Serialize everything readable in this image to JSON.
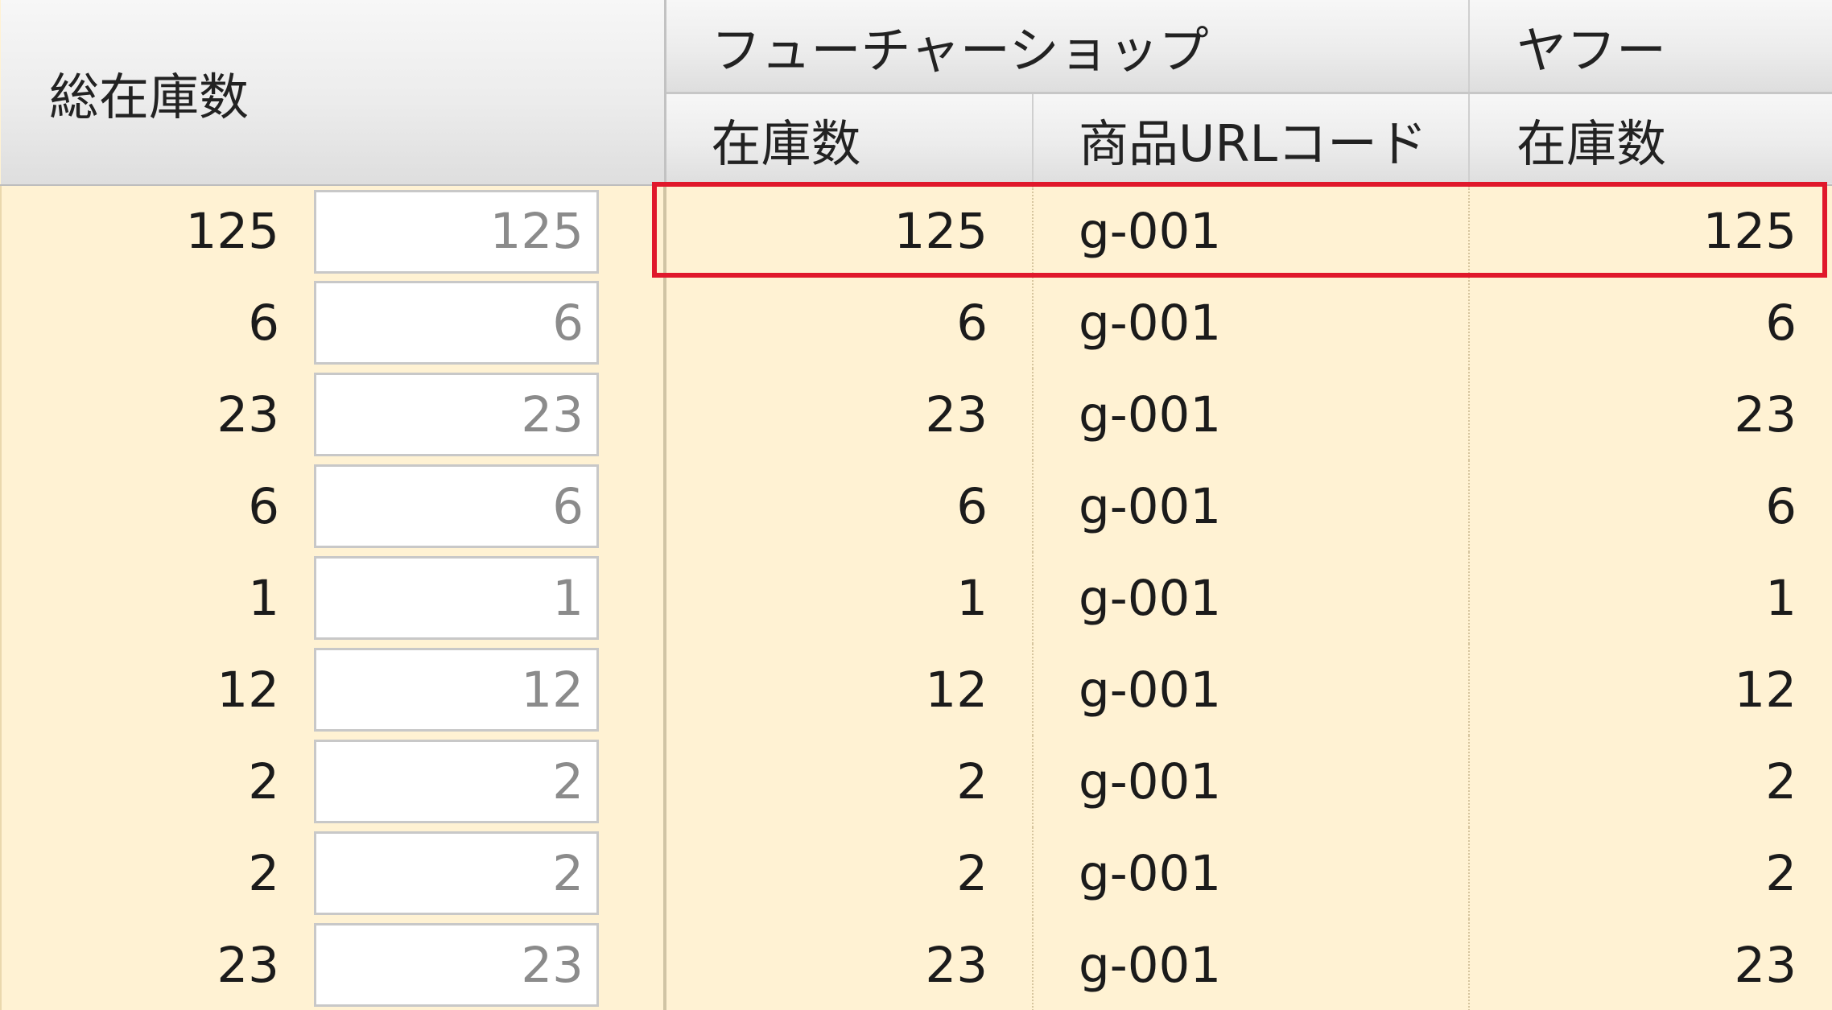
{
  "header": {
    "total_stock": "総在庫数",
    "future_shop": "フューチャーショップ",
    "yahoo": "ヤフー",
    "future_shop_stock": "在庫数",
    "future_shop_url_code": "商品URLコード",
    "yahoo_stock": "在庫数"
  },
  "rows": [
    {
      "total": "125",
      "input": "125",
      "fs_stock": "125",
      "fs_code": "g-001",
      "yahoo_stock": "125"
    },
    {
      "total": "6",
      "input": "6",
      "fs_stock": "6",
      "fs_code": "g-001",
      "yahoo_stock": "6"
    },
    {
      "total": "23",
      "input": "23",
      "fs_stock": "23",
      "fs_code": "g-001",
      "yahoo_stock": "23"
    },
    {
      "total": "6",
      "input": "6",
      "fs_stock": "6",
      "fs_code": "g-001",
      "yahoo_stock": "6"
    },
    {
      "total": "1",
      "input": "1",
      "fs_stock": "1",
      "fs_code": "g-001",
      "yahoo_stock": "1"
    },
    {
      "total": "12",
      "input": "12",
      "fs_stock": "12",
      "fs_code": "g-001",
      "yahoo_stock": "12"
    },
    {
      "total": "2",
      "input": "2",
      "fs_stock": "2",
      "fs_code": "g-001",
      "yahoo_stock": "2"
    },
    {
      "total": "2",
      "input": "2",
      "fs_stock": "2",
      "fs_code": "g-001",
      "yahoo_stock": "2"
    },
    {
      "total": "23",
      "input": "23",
      "fs_stock": "23",
      "fs_code": "g-001",
      "yahoo_stock": "23"
    }
  ],
  "highlight": {
    "row_index": 0,
    "color": "#e0182b"
  },
  "colors": {
    "row_background": "#fff2d3",
    "header_background": "#ececec",
    "input_text": "#8b8b8b"
  }
}
